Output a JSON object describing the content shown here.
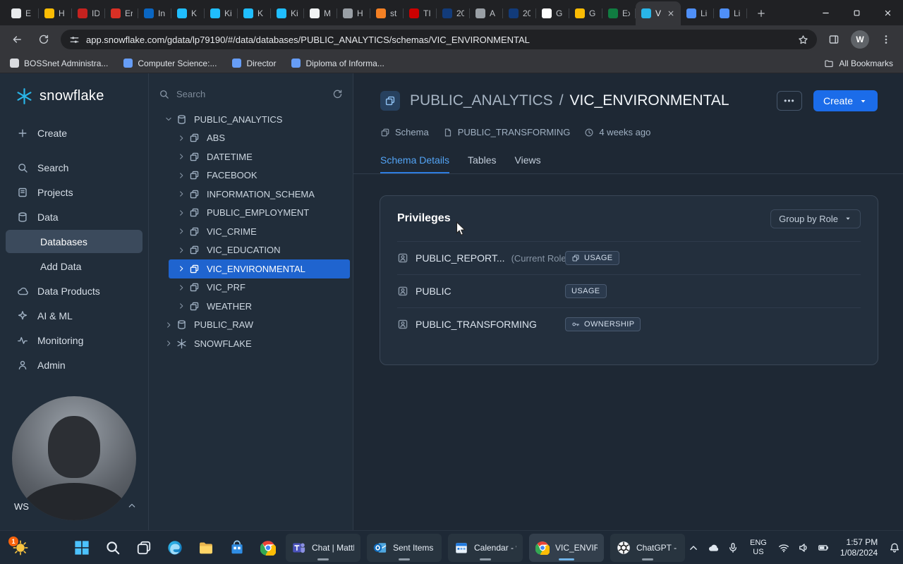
{
  "colors": {
    "accent": "#1b6ce9",
    "brand": "#29b5e8",
    "selection": "#1f64cf",
    "badge_border": "#49596f"
  },
  "browser": {
    "tabs": [
      {
        "title": "E",
        "fav": "#e8eaed"
      },
      {
        "title": "H",
        "fav": "#fbbc04"
      },
      {
        "title": "ID",
        "fav": "#c5221f"
      },
      {
        "title": "Er",
        "fav": "#d93025"
      },
      {
        "title": "In",
        "fav": "#0a66c2"
      },
      {
        "title": "K",
        "fav": "#20beff"
      },
      {
        "title": "Ki",
        "fav": "#20beff"
      },
      {
        "title": "K",
        "fav": "#20beff"
      },
      {
        "title": "Ki",
        "fav": "#20beff"
      },
      {
        "title": "M",
        "fav": "#f1f3f4"
      },
      {
        "title": "H",
        "fav": "#9aa0a6"
      },
      {
        "title": "st",
        "fav": "#f48024"
      },
      {
        "title": "TI",
        "fav": "#cc0000"
      },
      {
        "title": "20",
        "fav": "#123b7a"
      },
      {
        "title": "A",
        "fav": "#9aa0a6"
      },
      {
        "title": "20",
        "fav": "#123b7a"
      },
      {
        "title": "G",
        "fav": "#ffffff"
      },
      {
        "title": "G",
        "fav": "#fbbc04"
      },
      {
        "title": "Ex",
        "fav": "#107c41"
      },
      {
        "title": "V",
        "fav": "#29b5e8",
        "active": true
      },
      {
        "title": "Li",
        "fav": "#4f8ff7"
      },
      {
        "title": "Li",
        "fav": "#4f8ff7"
      }
    ],
    "url": "app.snowflake.com/gdata/lp79190/#/data/databases/PUBLIC_ANALYTICS/schemas/VIC_ENVIRONMENTAL",
    "profile_initial": "W",
    "bookmarks": [
      {
        "label": "BOSSnet Administra...",
        "fav": "#dadce0"
      },
      {
        "label": "Computer Science:...",
        "fav": "#669df6"
      },
      {
        "label": "Director",
        "fav": "#669df6"
      },
      {
        "label": "Diploma of Informa...",
        "fav": "#669df6"
      }
    ],
    "all_bookmarks": "All Bookmarks"
  },
  "app": {
    "brand": "snowflake",
    "user_initials": "WS",
    "nav": [
      {
        "label": "Create",
        "icon": "plus"
      },
      {
        "label": "Search",
        "icon": "search",
        "gap": true
      },
      {
        "label": "Projects",
        "icon": "projects"
      },
      {
        "label": "Data",
        "icon": "database"
      },
      {
        "label": "Databases",
        "sub": true,
        "selected": true
      },
      {
        "label": "Add Data",
        "sub": true
      },
      {
        "label": "Data Products",
        "icon": "cloud"
      },
      {
        "label": "AI & ML",
        "icon": "sparkle"
      },
      {
        "label": "Monitoring",
        "icon": "pulse"
      },
      {
        "label": "Admin",
        "icon": "person"
      }
    ],
    "explorer": {
      "search_placeholder": "Search",
      "tree": [
        {
          "label": "PUBLIC_ANALYTICS",
          "level": 0,
          "chevron": "chevron-down",
          "icon": "database"
        },
        {
          "label": "ABS",
          "level": 1,
          "chevron": "chevron-right",
          "icon": "schema"
        },
        {
          "label": "DATETIME",
          "level": 1,
          "chevron": "chevron-right",
          "icon": "schema"
        },
        {
          "label": "FACEBOOK",
          "level": 1,
          "chevron": "chevron-right",
          "icon": "schema"
        },
        {
          "label": "INFORMATION_SCHEMA",
          "level": 1,
          "chevron": "chevron-right",
          "icon": "schema"
        },
        {
          "label": "PUBLIC_EMPLOYMENT",
          "level": 1,
          "chevron": "chevron-right",
          "icon": "schema"
        },
        {
          "label": "VIC_CRIME",
          "level": 1,
          "chevron": "chevron-right",
          "icon": "schema"
        },
        {
          "label": "VIC_EDUCATION",
          "level": 1,
          "chevron": "chevron-right",
          "icon": "schema"
        },
        {
          "label": "VIC_ENVIRONMENTAL",
          "level": 1,
          "chevron": "chevron-right",
          "icon": "schema",
          "selected": true
        },
        {
          "label": "VIC_PRF",
          "level": 1,
          "chevron": "chevron-right",
          "icon": "schema"
        },
        {
          "label": "WEATHER",
          "level": 1,
          "chevron": "chevron-right",
          "icon": "schema"
        },
        {
          "label": "PUBLIC_RAW",
          "level": 0,
          "chevron": "chevron-right",
          "icon": "database"
        },
        {
          "label": "SNOWFLAKE",
          "level": 0,
          "chevron": "chevron-right",
          "icon": "snowflake"
        }
      ]
    },
    "header": {
      "breadcrumb_parent": "PUBLIC_ANALYTICS",
      "breadcrumb_sep": "/",
      "breadcrumb_current": "VIC_ENVIRONMENTAL",
      "more_label": "•••",
      "create_label": "Create"
    },
    "meta": [
      {
        "icon": "schema",
        "label": "Schema"
      },
      {
        "icon": "doc",
        "label": "PUBLIC_TRANSFORMING"
      },
      {
        "icon": "clock",
        "label": "4 weeks ago"
      }
    ],
    "tabs": [
      {
        "label": "Schema Details",
        "active": true
      },
      {
        "label": "Tables"
      },
      {
        "label": "Views"
      }
    ],
    "privileges": {
      "title": "Privileges",
      "group_by": "Group by Role",
      "rows": [
        {
          "name": "PUBLIC_REPORT...",
          "note": "(Current Role)",
          "badge": "USAGE",
          "badge_icon": "layers"
        },
        {
          "name": "PUBLIC",
          "note": "",
          "badge": "USAGE",
          "badge_icon": ""
        },
        {
          "name": "PUBLIC_TRANSFORMING",
          "note": "",
          "badge": "OWNERSHIP",
          "badge_icon": "key"
        }
      ]
    }
  },
  "taskbar": {
    "corner_badge": "1",
    "pinned": [
      "start",
      "search-tb",
      "taskview",
      "edge",
      "folder",
      "store",
      "chrome"
    ],
    "apps": [
      {
        "icon": "teams",
        "label": "Chat | Matth"
      },
      {
        "icon": "outlook",
        "label": "Sent Items -"
      },
      {
        "icon": "calendar",
        "label": "Calendar - w"
      },
      {
        "icon": "chrome",
        "label": "VIC_ENVIRO",
        "active": true
      },
      {
        "icon": "chatgpt",
        "label": "ChatGPT - G"
      }
    ],
    "tray": [
      "chevron-up",
      "cloud-solid",
      "mic"
    ],
    "language": [
      "ENG",
      "US"
    ],
    "status": [
      "wifi",
      "speaker",
      "battery"
    ],
    "time": "1:57 PM",
    "date": "1/08/2024",
    "far_right": [
      "bell",
      "people"
    ]
  }
}
